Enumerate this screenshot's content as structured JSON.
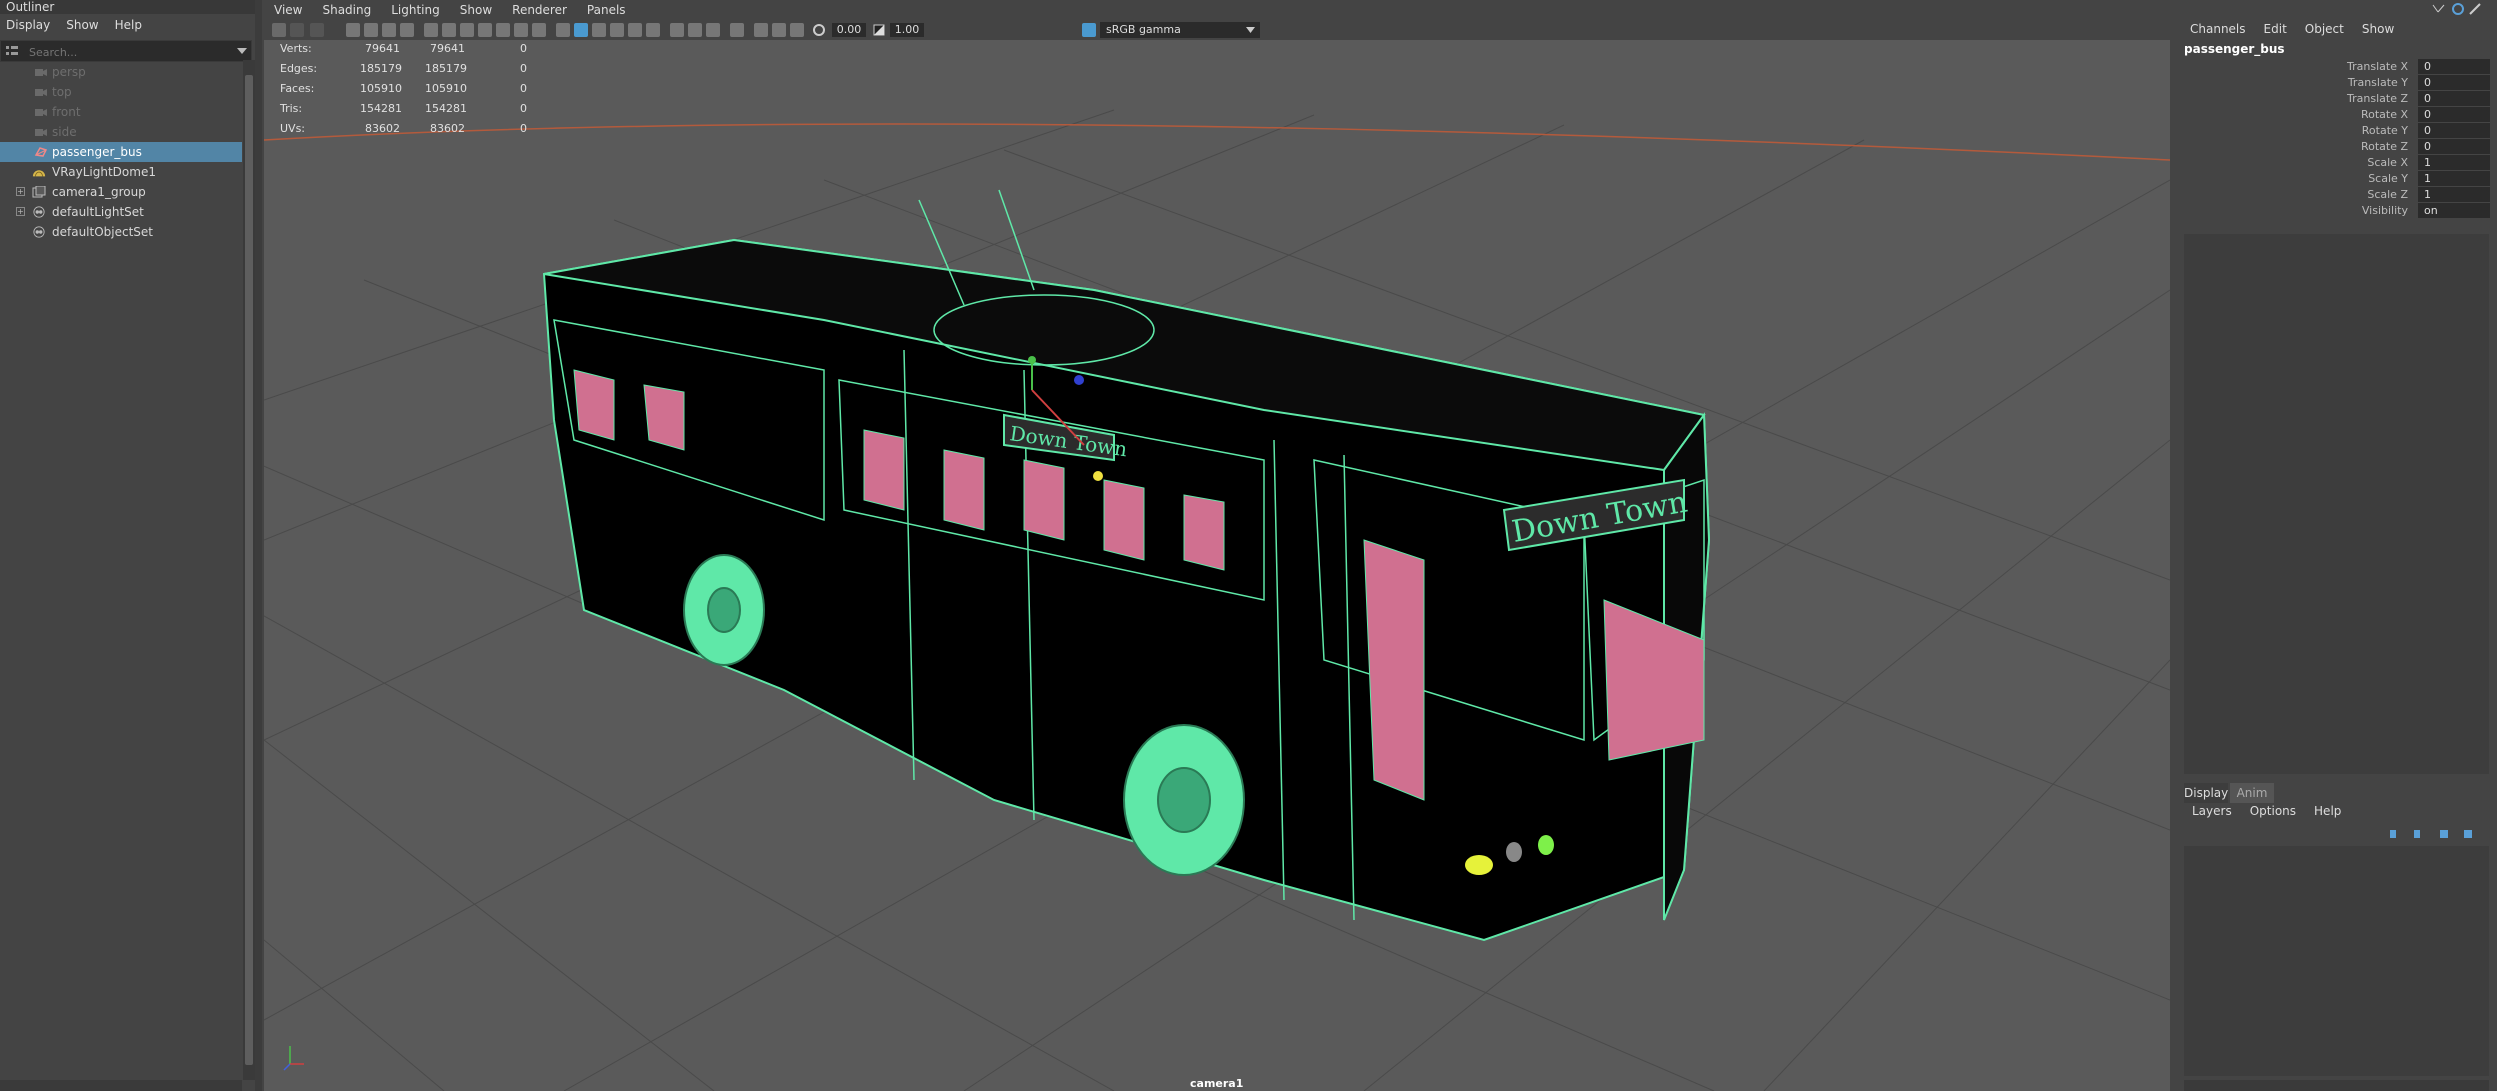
{
  "outliner": {
    "title": "Outliner",
    "menu": [
      "Display",
      "Show",
      "Help"
    ],
    "search_placeholder": "Search...",
    "items": [
      {
        "label": "persp",
        "icon": "camera-icon",
        "state": "dim"
      },
      {
        "label": "top",
        "icon": "camera-icon",
        "state": "dim"
      },
      {
        "label": "front",
        "icon": "camera-icon",
        "state": "dim"
      },
      {
        "label": "side",
        "icon": "camera-icon",
        "state": "dim"
      },
      {
        "label": "passenger_bus",
        "icon": "mesh-icon",
        "state": "selected"
      },
      {
        "label": "VRayLightDome1",
        "icon": "light-dome-icon",
        "state": "normal"
      },
      {
        "label": "camera1_group",
        "icon": "group-icon",
        "state": "normal"
      },
      {
        "label": "defaultLightSet",
        "icon": "set-icon",
        "state": "normal"
      },
      {
        "label": "defaultObjectSet",
        "icon": "set-icon",
        "state": "normal"
      }
    ]
  },
  "viewport": {
    "menu": [
      "View",
      "Shading",
      "Lighting",
      "Show",
      "Renderer",
      "Panels"
    ],
    "toolbar": {
      "exposure": "0.00",
      "gamma": "1.00",
      "color_space": "sRGB gamma"
    },
    "hud": [
      {
        "label": "Verts:",
        "v1": "79641",
        "v2": "79641",
        "v3": "0"
      },
      {
        "label": "Edges:",
        "v1": "185179",
        "v2": "185179",
        "v3": "0"
      },
      {
        "label": "Faces:",
        "v1": "105910",
        "v2": "105910",
        "v3": "0"
      },
      {
        "label": "Tris:",
        "v1": "154281",
        "v2": "154281",
        "v3": "0"
      },
      {
        "label": "UVs:",
        "v1": "83602",
        "v2": "83602",
        "v3": "0"
      }
    ],
    "camera": "camera1",
    "sign_text": "Down Town",
    "colors": {
      "wire": "#5fe8a8",
      "seat": "#d07090",
      "background": "#5a5a5a"
    }
  },
  "channels": {
    "menu": [
      "Channels",
      "Edit",
      "Object",
      "Show"
    ],
    "object": "passenger_bus",
    "attributes": [
      {
        "label": "Translate X",
        "value": "0"
      },
      {
        "label": "Translate Y",
        "value": "0"
      },
      {
        "label": "Translate Z",
        "value": "0"
      },
      {
        "label": "Rotate X",
        "value": "0"
      },
      {
        "label": "Rotate Y",
        "value": "0"
      },
      {
        "label": "Rotate Z",
        "value": "0"
      },
      {
        "label": "Scale X",
        "value": "1"
      },
      {
        "label": "Scale Y",
        "value": "1"
      },
      {
        "label": "Scale Z",
        "value": "1"
      },
      {
        "label": "Visibility",
        "value": "on"
      }
    ],
    "layer_tabs": [
      "Display",
      "Anim"
    ],
    "layer_menu": [
      "Layers",
      "Options",
      "Help"
    ]
  }
}
